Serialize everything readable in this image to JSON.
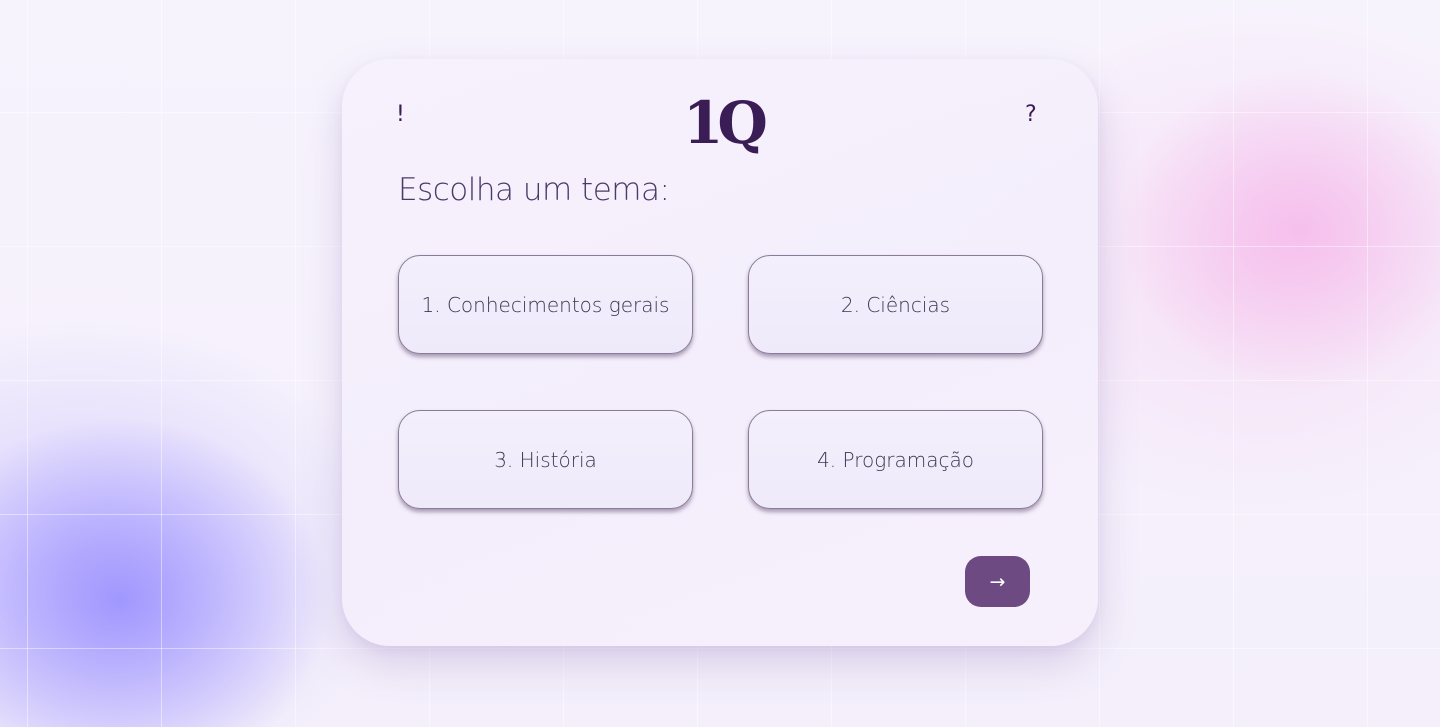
{
  "header": {
    "left_icon": "!",
    "left_icon_name": "info-icon",
    "logo_text": "1Q",
    "right_icon": "?",
    "right_icon_name": "help-icon"
  },
  "main": {
    "title": "Escolha um tema:",
    "topics": [
      {
        "label": "1. Conhecimentos gerais"
      },
      {
        "label": "2. Ciências"
      },
      {
        "label": "3. História"
      },
      {
        "label": "4. Programação"
      }
    ],
    "next_button": {
      "icon": "→",
      "icon_name": "arrow-right-icon"
    }
  },
  "colors": {
    "accent": "#6e4a83",
    "logo": "#3b1d55",
    "background_blob_left": "#968cff",
    "background_blob_right": "#f5b9eb"
  }
}
